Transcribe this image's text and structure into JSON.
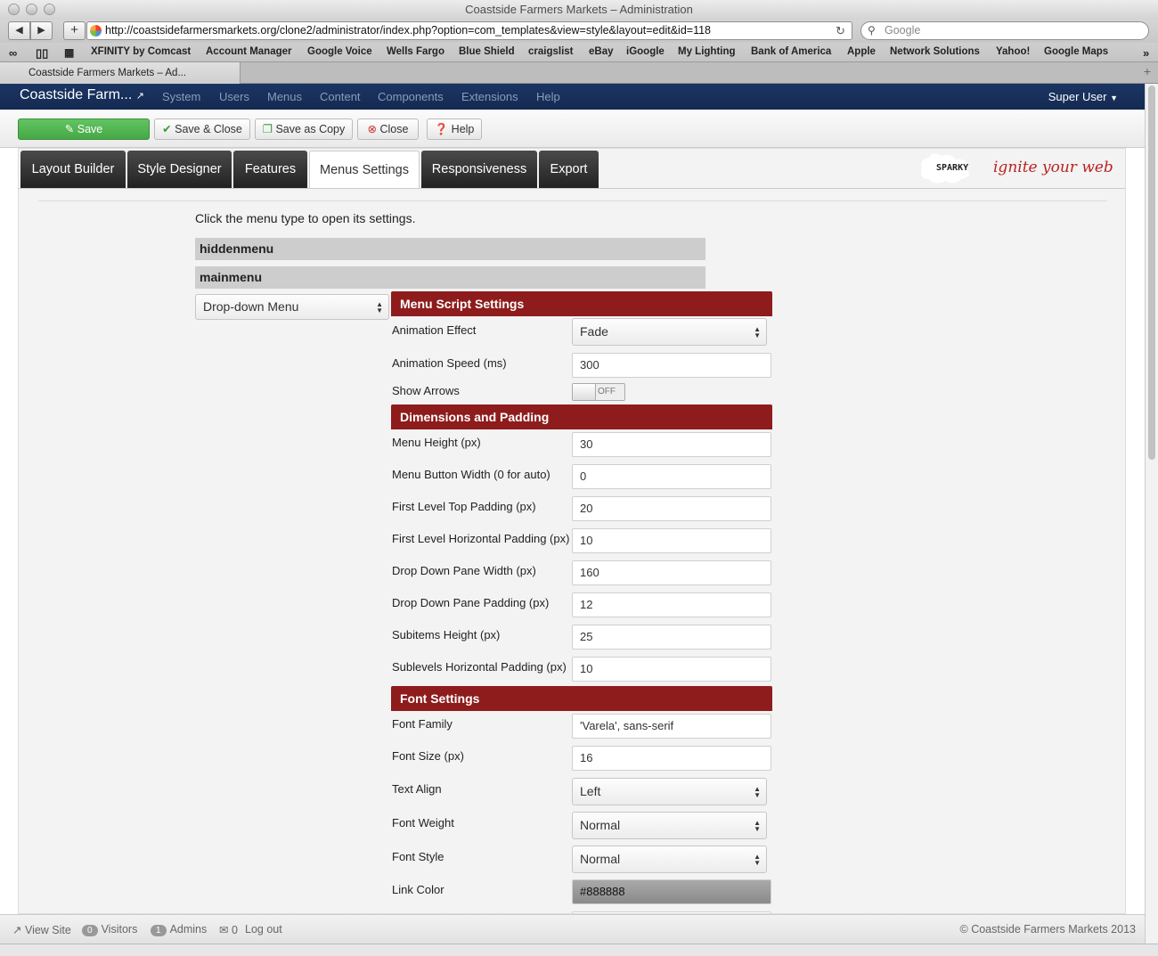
{
  "window": {
    "title": "Coastside Farmers Markets – Administration"
  },
  "browser": {
    "url": "http://coastsidefarmersmarkets.org/clone2/administrator/index.php?option=com_templates&view=style&layout=edit&id=118",
    "search_placeholder": "Google",
    "bookmarks": [
      "XFINITY by Comcast",
      "Account Manager",
      "Google Voice",
      "Wells Fargo",
      "Blue Shield",
      "craigslist",
      "eBay",
      "iGoogle",
      "My Lighting",
      "Bank of America",
      "Apple",
      "Network Solutions",
      "Yahoo!",
      "Google Maps"
    ],
    "tab_title": "Coastside Farmers Markets – Ad..."
  },
  "admin": {
    "brand": "Coastside Farm...",
    "menu": [
      "System",
      "Users",
      "Menus",
      "Content",
      "Components",
      "Extensions",
      "Help"
    ],
    "user": "Super User"
  },
  "toolbar": {
    "save": "Save",
    "save_close": "Save & Close",
    "save_copy": "Save as Copy",
    "close": "Close",
    "help": "Help"
  },
  "tabs": [
    "Layout Builder",
    "Style Designer",
    "Features",
    "Menus Settings",
    "Responsiveness",
    "Export"
  ],
  "active_tab": "Menus Settings",
  "sparky": {
    "logo": "SPARKY",
    "tagline": "ignite your web"
  },
  "hint": "Click the menu type to open its settings.",
  "menus": [
    "hiddenmenu",
    "mainmenu"
  ],
  "menu_type": "Drop-down Menu",
  "sections": {
    "script": "Menu Script Settings",
    "dimensions": "Dimensions and Padding",
    "font": "Font Settings"
  },
  "fields": {
    "animation_effect": {
      "label": "Animation Effect",
      "value": "Fade"
    },
    "animation_speed": {
      "label": "Animation Speed (ms)",
      "value": "300"
    },
    "show_arrows": {
      "label": "Show Arrows",
      "value": "OFF"
    },
    "menu_height": {
      "label": "Menu Height (px)",
      "value": "30"
    },
    "button_width": {
      "label": "Menu Button Width (0 for auto)",
      "value": "0"
    },
    "top_padding": {
      "label": "First Level Top Padding (px)",
      "value": "20"
    },
    "horiz_padding": {
      "label": "First Level Horizontal Padding (px)",
      "value": "10"
    },
    "pane_width": {
      "label": "Drop Down Pane Width (px)",
      "value": "160"
    },
    "pane_padding": {
      "label": "Drop Down Pane Padding (px)",
      "value": "12"
    },
    "subitems_height": {
      "label": "Subitems Height (px)",
      "value": "25"
    },
    "sublevels_padding": {
      "label": "Sublevels Horizontal Padding (px)",
      "value": "10"
    },
    "font_family": {
      "label": "Font Family",
      "value": "'Varela', sans-serif"
    },
    "font_size": {
      "label": "Font Size (px)",
      "value": "16"
    },
    "text_align": {
      "label": "Text Align",
      "value": "Left"
    },
    "font_weight": {
      "label": "Font Weight",
      "value": "Normal"
    },
    "font_style": {
      "label": "Font Style",
      "value": "Normal"
    },
    "link_color": {
      "label": "Link Color",
      "value": "#888888"
    }
  },
  "status": {
    "view_site": "View Site",
    "visitors_count": "0",
    "visitors": "Visitors",
    "admins_count": "1",
    "admins": "Admins",
    "messages_count": "0",
    "logout": "Log out",
    "copyright": "© Coastside Farmers Markets 2013"
  },
  "colors": {
    "section_header": "#8e1c1c",
    "admin_nav": "#1b3563",
    "save_button": "#51b551"
  }
}
